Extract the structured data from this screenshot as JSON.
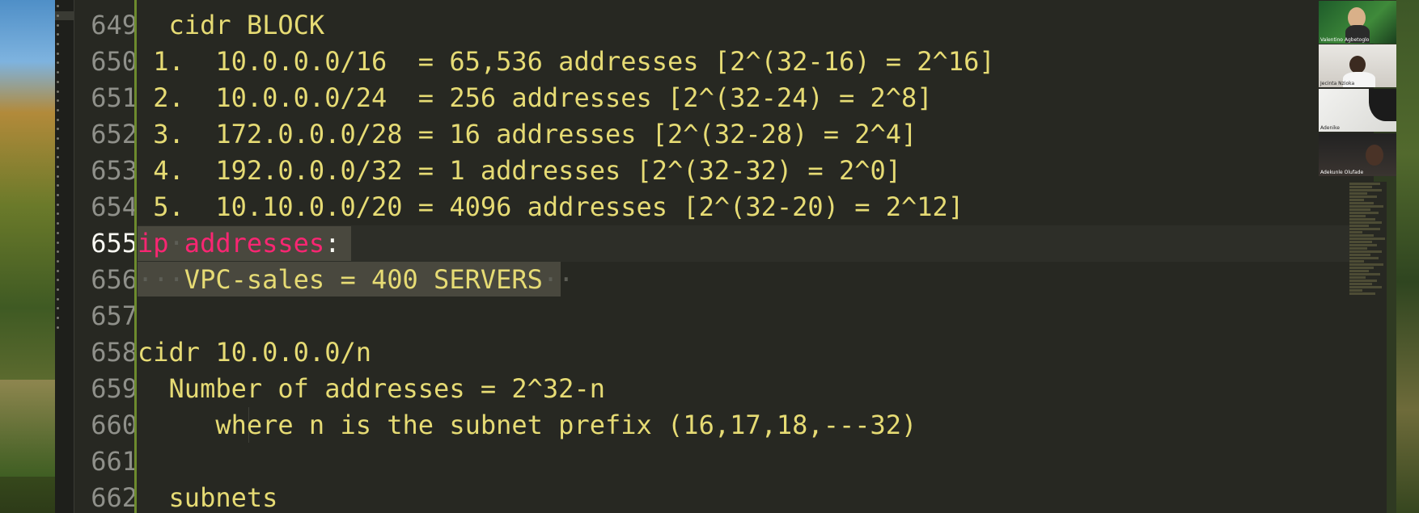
{
  "editor": {
    "lines": [
      {
        "no": "649",
        "text": "  cidr BLOCK"
      },
      {
        "no": "650",
        "text": " 1.  10.0.0.0/16  = 65,536 addresses [2^(32-16) = 2^16]"
      },
      {
        "no": "651",
        "text": " 2.  10.0.0.0/24  = 256 addresses [2^(32-24) = 2^8]"
      },
      {
        "no": "652",
        "text": " 3.  172.0.0.0/28 = 16 addresses [2^(32-28) = 2^4]"
      },
      {
        "no": "653",
        "text": " 4.  192.0.0.0/32 = 1 addresses [2^(32-32) = 2^0]"
      },
      {
        "no": "654",
        "text": " 5.  10.10.0.0/20 = 4096 addresses [2^(32-20) = 2^12]"
      },
      {
        "no": "655",
        "text_kw1": "ip",
        "text_kw2": "addresses",
        "text_punct": ":"
      },
      {
        "no": "656",
        "text": "VPC-sales = 400 SERVERS"
      },
      {
        "no": "657",
        "text": ""
      },
      {
        "no": "658",
        "text": "cidr 10.0.0.0/n"
      },
      {
        "no": "659",
        "text": "  Number of addresses = 2^32-n"
      },
      {
        "no": "660",
        "text": "     where n is the subnet prefix (16,17,18,---32)"
      },
      {
        "no": "661",
        "text": ""
      },
      {
        "no": "662",
        "text": "  subnets"
      }
    ]
  },
  "participants": [
    {
      "name": "Valentino Agbetoglo"
    },
    {
      "name": "Jecinta Nzioka"
    },
    {
      "name": "Adenike"
    },
    {
      "name": "Adekunle Olufade"
    }
  ],
  "colors": {
    "editor_bg": "#272822",
    "string_yellow": "#e6db74",
    "keyword_pink": "#f92672",
    "gutter_text": "#8f908a",
    "selection": "#49483e"
  }
}
